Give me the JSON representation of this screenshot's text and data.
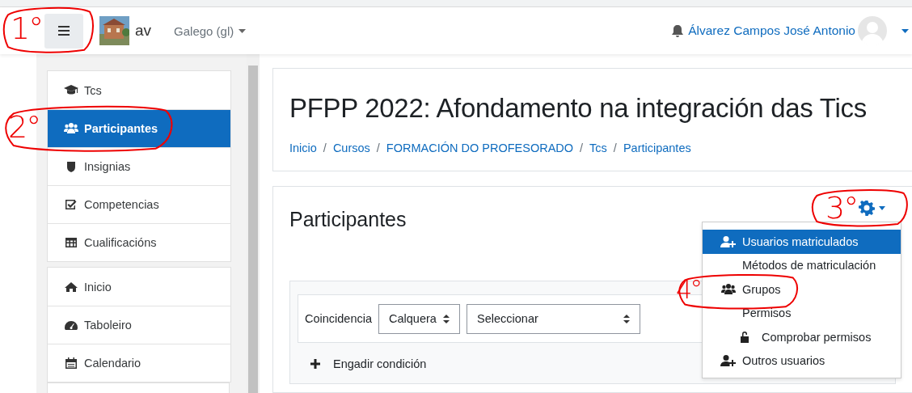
{
  "navbar": {
    "site_name": "av",
    "language": "Galego (gl)",
    "user_name": "Álvarez Campos José Antonio"
  },
  "sidebar": {
    "groups": [
      [
        {
          "label": "Tcs",
          "kind": "cap",
          "selected": false
        },
        {
          "label": "Participantes",
          "kind": "users",
          "selected": true
        },
        {
          "label": "Insignias",
          "kind": "shield",
          "selected": false
        },
        {
          "label": "Competencias",
          "kind": "check",
          "selected": false
        },
        {
          "label": "Cualificacións",
          "kind": "table",
          "selected": false
        }
      ],
      [
        {
          "label": "Inicio",
          "kind": "home",
          "selected": false
        },
        {
          "label": "Taboleiro",
          "kind": "gauge",
          "selected": false
        },
        {
          "label": "Calendario",
          "kind": "calendar",
          "selected": false
        }
      ]
    ]
  },
  "course": {
    "title": "PFPP 2022: Afondamento na integración das Tics",
    "breadcrumbs": [
      {
        "label": "Inicio"
      },
      {
        "separator": "/",
        "label": "Cursos"
      },
      {
        "separator": "/",
        "label": "FORMACIÓN DO PROFESORADO"
      },
      {
        "separator": "/",
        "label": "Tcs"
      },
      {
        "separator": "/",
        "label": "Participantes"
      }
    ]
  },
  "page": {
    "heading": "Participantes"
  },
  "filter": {
    "match_label": "Coincidencia",
    "match_value": "Calquera",
    "select_value": "Seleccionar",
    "add_condition": "Engadir condición"
  },
  "settings_menu": {
    "items": [
      {
        "label": "Usuarios matriculados",
        "kind": "user-plus",
        "selected": true,
        "indented": false
      },
      {
        "label": "Métodos de matriculación",
        "kind": "plain",
        "selected": false,
        "indented": false
      },
      {
        "label": "Grupos",
        "kind": "users",
        "selected": false,
        "indented": false
      },
      {
        "label": "Permisos",
        "kind": "plain",
        "selected": false,
        "indented": false
      },
      {
        "label": "Comprobar permisos",
        "kind": "lock",
        "selected": false,
        "indented": true
      },
      {
        "label": "Outros usuarios",
        "kind": "user-plus",
        "selected": false,
        "indented": false
      }
    ]
  },
  "annotations": [
    {
      "label": "1°"
    },
    {
      "label": "2°"
    },
    {
      "label": "3°"
    },
    {
      "label": "4°"
    }
  ]
}
